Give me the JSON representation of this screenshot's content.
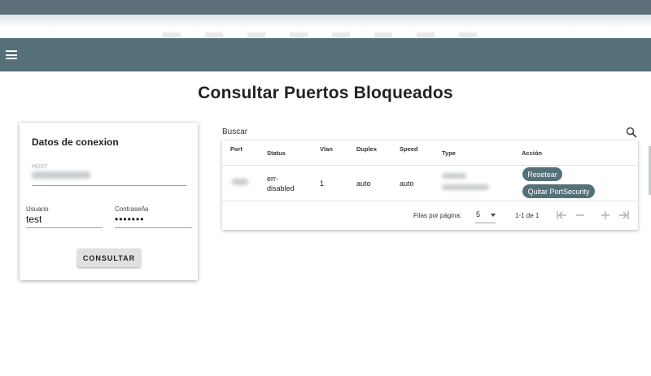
{
  "page": {
    "title": "Consultar Puertos Bloqueados"
  },
  "appbar": {
    "menu_icon": "hamburger-menu-icon"
  },
  "login": {
    "title": "Datos de conexion",
    "host_label": "HOST",
    "user_label": "Usuario",
    "user_value": "test",
    "password_label": "Contraseña",
    "password_value": "•••••••",
    "submit_label": "CONSULTAR"
  },
  "search": {
    "label": "Buscar",
    "icon": "search-icon"
  },
  "table": {
    "columns": [
      "Port",
      "Status",
      "Vlan",
      "Duplex",
      "Speed",
      "Type",
      "Acción"
    ],
    "rows": [
      {
        "status": "err-disabled",
        "status_line1": "err-",
        "status_line2": "disabled",
        "vlan": "1",
        "duplex": "auto",
        "speed": "auto",
        "actions": [
          "Resetear",
          "Quitar PortSecurity"
        ]
      }
    ],
    "footer": {
      "rows_per_page_label": "Filas por página:",
      "rows_per_page_value": "5",
      "range": "1-1 de 1"
    }
  },
  "colors": {
    "appbar": "#56707a",
    "accent_button": "#56707a"
  }
}
